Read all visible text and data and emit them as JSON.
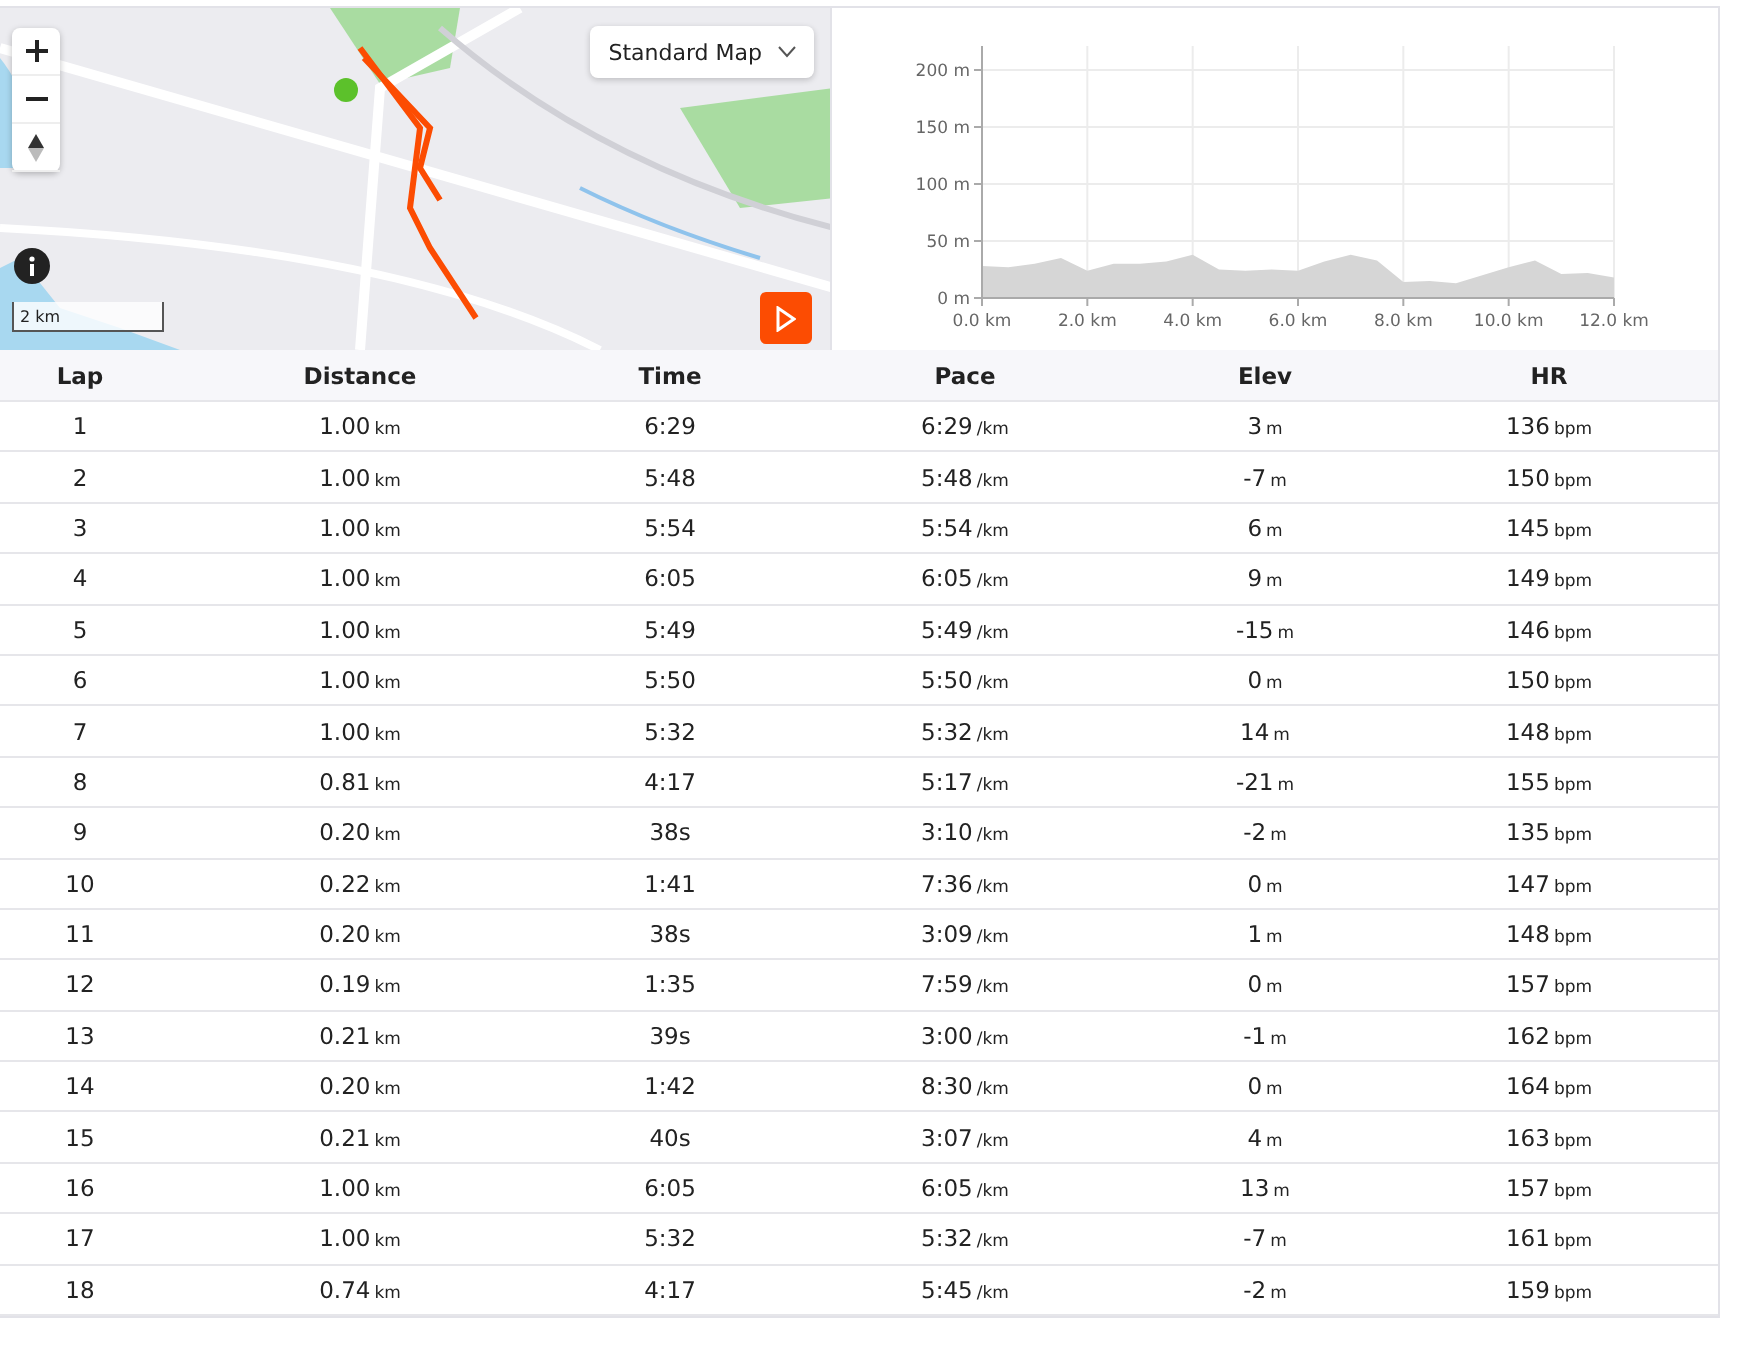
{
  "map": {
    "map_type": "Standard Map",
    "scale": "2 km"
  },
  "elevation_chart": {
    "chart_data": {
      "type": "area",
      "grid": true,
      "xlim": [
        0,
        12
      ],
      "ylim": [
        0,
        200
      ],
      "x": [
        0,
        0.5,
        1,
        1.5,
        2,
        2.5,
        3,
        3.5,
        4,
        4.5,
        5,
        5.5,
        6,
        6.5,
        7,
        7.5,
        8,
        8.5,
        9,
        9.5,
        10,
        10.5,
        11,
        11.5,
        12
      ],
      "series": [
        {
          "color": "#d6d6d6",
          "values": [
            28,
            27,
            30,
            35,
            24,
            30,
            30,
            32,
            38,
            25,
            24,
            25,
            24,
            32,
            38,
            33,
            14,
            15,
            13,
            20,
            27,
            33,
            21,
            22,
            18
          ]
        }
      ],
      "xticks": [
        {
          "value": 0,
          "label": "0.0 km"
        },
        {
          "value": 2,
          "label": "2.0 km"
        },
        {
          "value": 4,
          "label": "4.0 km"
        },
        {
          "value": 6,
          "label": "6.0 km"
        },
        {
          "value": 8,
          "label": "8.0 km"
        },
        {
          "value": 10,
          "label": "10.0 km"
        },
        {
          "value": 12,
          "label": "12.0 km"
        }
      ],
      "yticks": [
        {
          "value": 0,
          "label": "0 m"
        },
        {
          "value": 50,
          "label": "50 m"
        },
        {
          "value": 100,
          "label": "100 m"
        },
        {
          "value": 150,
          "label": "150 m"
        },
        {
          "value": 200,
          "label": "200 m"
        }
      ]
    }
  },
  "table": {
    "columns": [
      "Lap",
      "Distance",
      "Time",
      "Pace",
      "Elev",
      "HR"
    ],
    "rows": [
      {
        "lap": "1",
        "distance": "1.00",
        "distance_unit": "km",
        "time": "6:29",
        "pace": "6:29",
        "pace_unit": "/km",
        "elev": "3",
        "elev_unit": "m",
        "hr": "136",
        "hr_unit": "bpm"
      },
      {
        "lap": "2",
        "distance": "1.00",
        "distance_unit": "km",
        "time": "5:48",
        "pace": "5:48",
        "pace_unit": "/km",
        "elev": "-7",
        "elev_unit": "m",
        "hr": "150",
        "hr_unit": "bpm"
      },
      {
        "lap": "3",
        "distance": "1.00",
        "distance_unit": "km",
        "time": "5:54",
        "pace": "5:54",
        "pace_unit": "/km",
        "elev": "6",
        "elev_unit": "m",
        "hr": "145",
        "hr_unit": "bpm"
      },
      {
        "lap": "4",
        "distance": "1.00",
        "distance_unit": "km",
        "time": "6:05",
        "pace": "6:05",
        "pace_unit": "/km",
        "elev": "9",
        "elev_unit": "m",
        "hr": "149",
        "hr_unit": "bpm"
      },
      {
        "lap": "5",
        "distance": "1.00",
        "distance_unit": "km",
        "time": "5:49",
        "pace": "5:49",
        "pace_unit": "/km",
        "elev": "-15",
        "elev_unit": "m",
        "hr": "146",
        "hr_unit": "bpm"
      },
      {
        "lap": "6",
        "distance": "1.00",
        "distance_unit": "km",
        "time": "5:50",
        "pace": "5:50",
        "pace_unit": "/km",
        "elev": "0",
        "elev_unit": "m",
        "hr": "150",
        "hr_unit": "bpm"
      },
      {
        "lap": "7",
        "distance": "1.00",
        "distance_unit": "km",
        "time": "5:32",
        "pace": "5:32",
        "pace_unit": "/km",
        "elev": "14",
        "elev_unit": "m",
        "hr": "148",
        "hr_unit": "bpm"
      },
      {
        "lap": "8",
        "distance": "0.81",
        "distance_unit": "km",
        "time": "4:17",
        "pace": "5:17",
        "pace_unit": "/km",
        "elev": "-21",
        "elev_unit": "m",
        "hr": "155",
        "hr_unit": "bpm"
      },
      {
        "lap": "9",
        "distance": "0.20",
        "distance_unit": "km",
        "time": "38s",
        "pace": "3:10",
        "pace_unit": "/km",
        "elev": "-2",
        "elev_unit": "m",
        "hr": "135",
        "hr_unit": "bpm"
      },
      {
        "lap": "10",
        "distance": "0.22",
        "distance_unit": "km",
        "time": "1:41",
        "pace": "7:36",
        "pace_unit": "/km",
        "elev": "0",
        "elev_unit": "m",
        "hr": "147",
        "hr_unit": "bpm"
      },
      {
        "lap": "11",
        "distance": "0.20",
        "distance_unit": "km",
        "time": "38s",
        "pace": "3:09",
        "pace_unit": "/km",
        "elev": "1",
        "elev_unit": "m",
        "hr": "148",
        "hr_unit": "bpm"
      },
      {
        "lap": "12",
        "distance": "0.19",
        "distance_unit": "km",
        "time": "1:35",
        "pace": "7:59",
        "pace_unit": "/km",
        "elev": "0",
        "elev_unit": "m",
        "hr": "157",
        "hr_unit": "bpm"
      },
      {
        "lap": "13",
        "distance": "0.21",
        "distance_unit": "km",
        "time": "39s",
        "pace": "3:00",
        "pace_unit": "/km",
        "elev": "-1",
        "elev_unit": "m",
        "hr": "162",
        "hr_unit": "bpm"
      },
      {
        "lap": "14",
        "distance": "0.20",
        "distance_unit": "km",
        "time": "1:42",
        "pace": "8:30",
        "pace_unit": "/km",
        "elev": "0",
        "elev_unit": "m",
        "hr": "164",
        "hr_unit": "bpm"
      },
      {
        "lap": "15",
        "distance": "0.21",
        "distance_unit": "km",
        "time": "40s",
        "pace": "3:07",
        "pace_unit": "/km",
        "elev": "4",
        "elev_unit": "m",
        "hr": "163",
        "hr_unit": "bpm"
      },
      {
        "lap": "16",
        "distance": "1.00",
        "distance_unit": "km",
        "time": "6:05",
        "pace": "6:05",
        "pace_unit": "/km",
        "elev": "13",
        "elev_unit": "m",
        "hr": "157",
        "hr_unit": "bpm"
      },
      {
        "lap": "17",
        "distance": "1.00",
        "distance_unit": "km",
        "time": "5:32",
        "pace": "5:32",
        "pace_unit": "/km",
        "elev": "-7",
        "elev_unit": "m",
        "hr": "161",
        "hr_unit": "bpm"
      },
      {
        "lap": "18",
        "distance": "0.74",
        "distance_unit": "km",
        "time": "4:17",
        "pace": "5:45",
        "pace_unit": "/km",
        "elev": "-2",
        "elev_unit": "m",
        "hr": "159",
        "hr_unit": "bpm"
      }
    ]
  }
}
